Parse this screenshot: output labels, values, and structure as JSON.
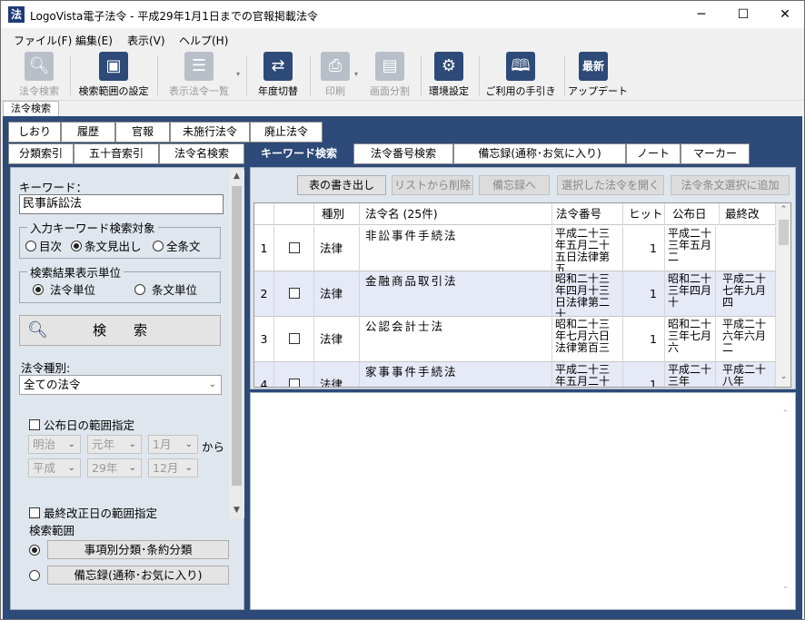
{
  "window": {
    "app_icon": "法",
    "title": "LogoVista電子法令 - 平成29年1月1日までの官報掲載法令",
    "minimize": "─",
    "maximize": "☐",
    "close": "✕"
  },
  "menu": [
    "ファイル(F)",
    "編集(E)",
    "表示(V)",
    "ヘルプ(H)"
  ],
  "toolbar": [
    {
      "label": "法令検索",
      "icon": "search-icon",
      "enabled": false
    },
    {
      "label": "検索範囲の設定",
      "icon": "range-icon",
      "enabled": true
    },
    {
      "label": "表示法令一覧",
      "icon": "list-icon",
      "enabled": false
    },
    {
      "label": "年度切替",
      "icon": "switch-icon",
      "enabled": true
    },
    {
      "label": "印刷",
      "icon": "print-icon",
      "enabled": false
    },
    {
      "label": "画面分割",
      "icon": "split-icon",
      "enabled": false
    },
    {
      "label": "環境設定",
      "icon": "gear-icon",
      "enabled": true
    },
    {
      "label": "ご利用の手引き",
      "icon": "book-icon",
      "enabled": true
    },
    {
      "label": "アップデート",
      "icon": "update-icon",
      "enabled": true
    }
  ],
  "update_icon_text": "最新",
  "main_tab": "法令検索",
  "tabs_row1": [
    "しおり",
    "履歴",
    "官報",
    "未施行法令",
    "廃止法令"
  ],
  "tabs_row2": [
    "分類索引",
    "五十音索引",
    "法令名検索",
    "キーワード検索",
    "法令番号検索",
    "備忘録(通称･お気に入り)",
    "ノート",
    "マーカー"
  ],
  "left": {
    "keyword_label": "キーワード：",
    "keyword_value": "民事訴訟法",
    "target_legend": "入力キーワード検索対象",
    "target_options": [
      "目次",
      "条文見出し",
      "全条文"
    ],
    "unit_legend": "検索結果表示単位",
    "unit_options": [
      "法令単位",
      "条文単位"
    ],
    "search_button": "検　　索",
    "type_label": "法令種別:",
    "type_value": "全ての法令",
    "pub_range_label": "公布日の範囲指定",
    "era_from": "明治",
    "year_from": "元年",
    "month_from": "1月",
    "from_label": "から",
    "era_to": "平成",
    "year_to": "29年",
    "month_to": "12月",
    "rev_range_label": "最終改正日の範囲指定",
    "scope_label": "検索範囲",
    "scope_options": [
      "事項別分類･条約分類",
      "備忘録(通称･お気に入り)"
    ]
  },
  "results": {
    "buttons": [
      "表の書き出し",
      "リストから削除",
      "備忘録へ",
      "選択した法令を開く",
      "法令条文選択に追加"
    ],
    "headers": [
      "",
      "",
      "種別",
      "法令名 (25件)",
      "法令番号",
      "ヒット",
      "公布日",
      "最終改"
    ],
    "rows": [
      {
        "num": "1",
        "type": "法律",
        "name": "非訟事件手続法",
        "number": "平成二十三年五月二十五日法律第五",
        "hits": "1",
        "promulgated": "平成二十三年五月二",
        "revised": ""
      },
      {
        "num": "2",
        "type": "法律",
        "name": "金融商品取引法",
        "number": "昭和二十三年四月十三日法律第二十",
        "hits": "1",
        "promulgated": "昭和二十三年四月十",
        "revised": "平成二十七年九月四"
      },
      {
        "num": "3",
        "type": "法律",
        "name": "公認会計士法",
        "number": "昭和二十三年七月六日法律第百三",
        "hits": "1",
        "promulgated": "昭和二十三年七月六",
        "revised": "平成二十六年六月二"
      },
      {
        "num": "4",
        "type": "法律",
        "name": "家事事件手続法",
        "number": "平成二十三年五月二十",
        "hits": "1",
        "promulgated": "平成二十三年",
        "revised": "平成二十八年"
      }
    ]
  },
  "colors": {
    "accent": "#2d4a78",
    "row_alt": "#e6e9f6"
  }
}
